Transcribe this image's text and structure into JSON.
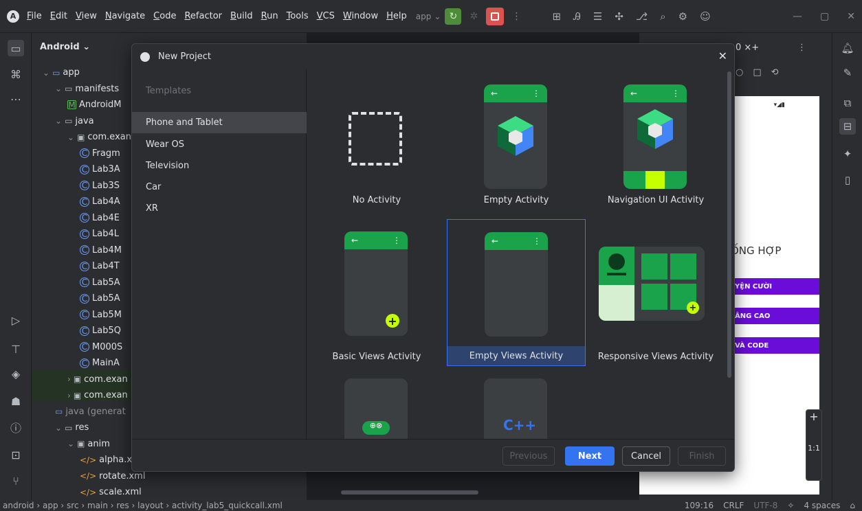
{
  "menu": [
    "File",
    "Edit",
    "View",
    "Navigate",
    "Code",
    "Refactor",
    "Build",
    "Run",
    "Tools",
    "VCS",
    "Window",
    "Help"
  ],
  "run_config": "app",
  "project": {
    "header": "Android",
    "tree": [
      {
        "label": "app",
        "indent": 0,
        "icon": "folder-app"
      },
      {
        "label": "manifests",
        "indent": 1,
        "icon": "folder"
      },
      {
        "label": "AndroidM",
        "indent": 2,
        "icon": "manifest"
      },
      {
        "label": "java",
        "indent": 1,
        "icon": "folder"
      },
      {
        "label": "com.exan",
        "indent": 2,
        "icon": "package"
      },
      {
        "label": "Fragm",
        "indent": 3,
        "icon": "class"
      },
      {
        "label": "Lab3A",
        "indent": 3,
        "icon": "class"
      },
      {
        "label": "Lab3S",
        "indent": 3,
        "icon": "class"
      },
      {
        "label": "Lab4A",
        "indent": 3,
        "icon": "class"
      },
      {
        "label": "Lab4E",
        "indent": 3,
        "icon": "class"
      },
      {
        "label": "Lab4L",
        "indent": 3,
        "icon": "class"
      },
      {
        "label": "Lab4M",
        "indent": 3,
        "icon": "class"
      },
      {
        "label": "Lab4T",
        "indent": 3,
        "icon": "class"
      },
      {
        "label": "Lab5A",
        "indent": 3,
        "icon": "class"
      },
      {
        "label": "Lab5A",
        "indent": 3,
        "icon": "class"
      },
      {
        "label": "Lab5M",
        "indent": 3,
        "icon": "class"
      },
      {
        "label": "Lab5Q",
        "indent": 3,
        "icon": "class"
      },
      {
        "label": "M000S",
        "indent": 3,
        "icon": "class"
      },
      {
        "label": "MainA",
        "indent": 3,
        "icon": "class"
      },
      {
        "label": "com.exan",
        "indent": 2,
        "icon": "package"
      },
      {
        "label": "com.exan",
        "indent": 2,
        "icon": "package"
      },
      {
        "label": "java (generat",
        "indent": 1,
        "icon": "folder-gen"
      },
      {
        "label": "res",
        "indent": 1,
        "icon": "folder-res"
      },
      {
        "label": "anim",
        "indent": 2,
        "icon": "package"
      },
      {
        "label": "alpha.x",
        "indent": 3,
        "icon": "xml"
      },
      {
        "label": "rotate.xml",
        "indent": 3,
        "icon": "xml"
      },
      {
        "label": "scale.xml",
        "indent": 3,
        "icon": "xml"
      }
    ]
  },
  "dialog": {
    "title": "New Project",
    "templates_header": "Templates",
    "categories": [
      "Phone and Tablet",
      "Wear OS",
      "Television",
      "Car",
      "XR"
    ],
    "selected_category": "Phone and Tablet",
    "cards": [
      "No Activity",
      "Empty Activity",
      "Navigation UI Activity",
      "Basic Views Activity",
      "Empty Views Activity",
      "Responsive Views Activity"
    ],
    "selected_card": "Empty Views Activity",
    "buttons": {
      "previous": "Previous",
      "next": "Next",
      "cancel": "Cancel",
      "finish": "Finish"
    }
  },
  "preview": {
    "heading": "ỐNG HỢP",
    "btn1": "YỆN CƯỜI",
    "btn2": "ÂNG CAO",
    "btn3": "VÀ CODE",
    "zoom_label": "1:1",
    "plus": "+",
    "tab_text": "0 ×+"
  },
  "status": {
    "breadcrumb": [
      "android",
      "app",
      "src",
      "main",
      "res",
      "layout",
      "activity_lab5_quickcall.xml"
    ],
    "position": "109:16",
    "line_sep": "CRLF",
    "encoding": "UTF-8",
    "indent": "4 spaces"
  },
  "colors": {
    "accent": "#3574f0",
    "green": "#1aa34a",
    "purple": "#6a0dd9"
  }
}
